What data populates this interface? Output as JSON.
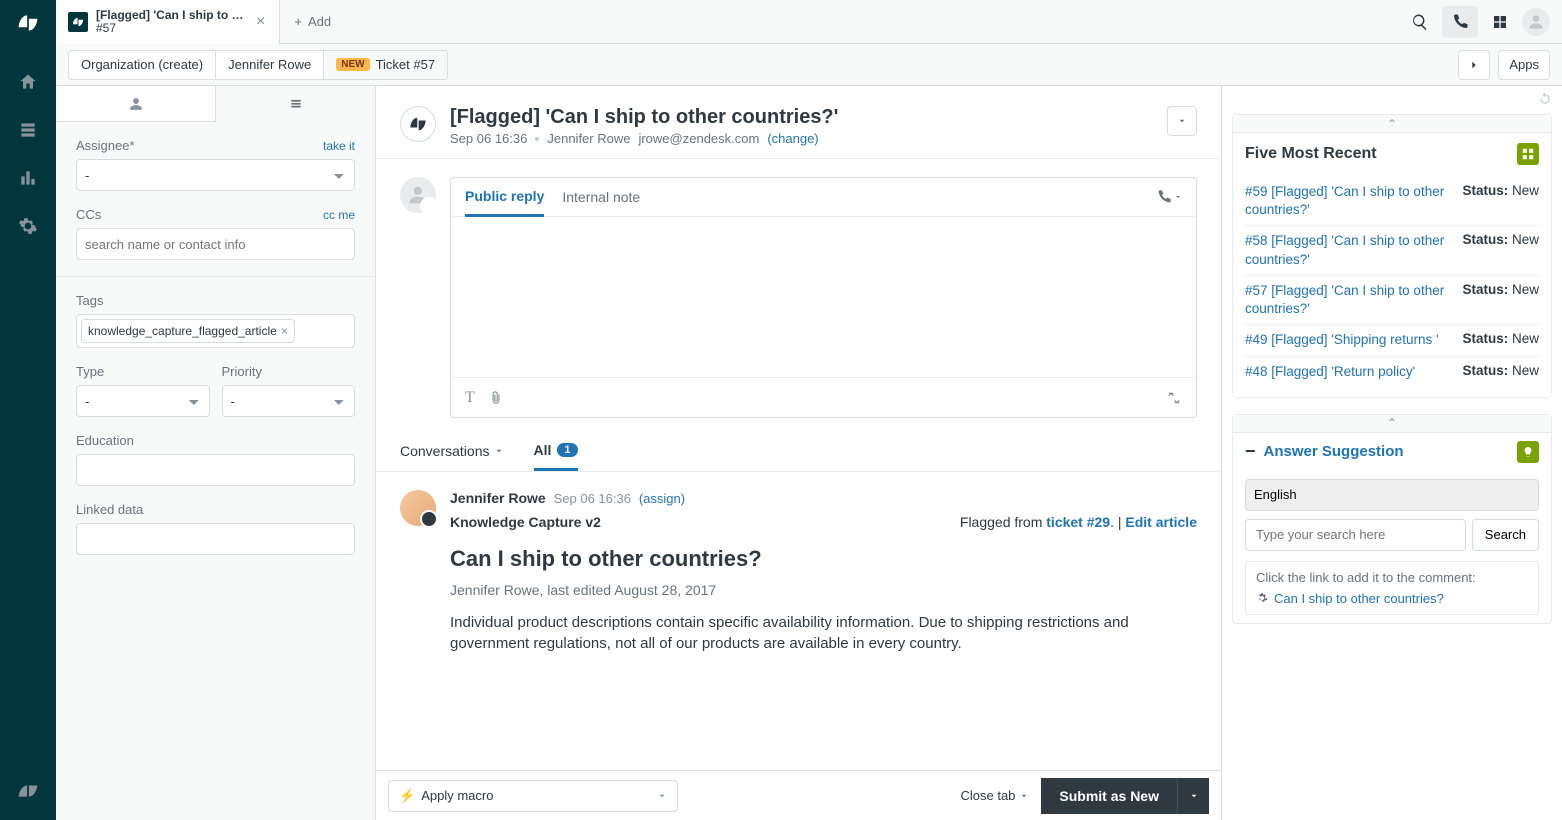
{
  "topbar": {
    "tab_title": "[Flagged] 'Can I ship to o...",
    "tab_subtitle": "#57",
    "add_label": "Add"
  },
  "subbar": {
    "crumb1": "Organization (create)",
    "crumb2": "Jennifer Rowe",
    "crumb3_badge": "NEW",
    "crumb3": "Ticket #57",
    "apps_label": "Apps"
  },
  "left": {
    "assignee_label": "Assignee*",
    "take_it": "take it",
    "assignee_value": "-",
    "ccs_label": "CCs",
    "cc_me": "cc me",
    "ccs_placeholder": "search name or contact info",
    "tags_label": "Tags",
    "tag1": "knowledge_capture_flagged_article",
    "type_label": "Type",
    "type_value": "-",
    "priority_label": "Priority",
    "priority_value": "-",
    "education_label": "Education",
    "linked_label": "Linked data"
  },
  "ticket": {
    "title": "[Flagged] 'Can I ship to other countries?'",
    "date": "Sep 06 16:36",
    "requester": "Jennifer Rowe",
    "email": "jrowe@zendesk.com",
    "change": "(change)",
    "public_reply": "Public reply",
    "internal_note": "Internal note",
    "conversations": "Conversations",
    "all": "All",
    "all_count": "1"
  },
  "conv": {
    "name": "Jennifer Rowe",
    "time": "Sep 06 16:36",
    "assign": "(assign)",
    "kc_title": "Knowledge Capture v2",
    "flagged_from": "Flagged from ",
    "ticket_link": "ticket #29",
    "sep": ". | ",
    "edit_article": "Edit article",
    "article_title": "Can I ship to other countries?",
    "article_meta": "Jennifer Rowe, last edited August 28, 2017",
    "article_body": "Individual product descriptions contain specific availability information. Due to shipping restrictions and government regulations, not all of our products are available in every country."
  },
  "foot": {
    "macro": "Apply macro",
    "close_tab": "Close tab",
    "submit": "Submit as New"
  },
  "right": {
    "recent_title": "Five Most Recent",
    "items": [
      {
        "title": "#59 [Flagged] 'Can I ship to other countries?'",
        "status": "New"
      },
      {
        "title": "#58 [Flagged] 'Can I ship to other countries?'",
        "status": "New"
      },
      {
        "title": "#57 [Flagged] 'Can I ship to other countries?'",
        "status": "New"
      },
      {
        "title": "#49 [Flagged] 'Shipping returns '",
        "status": "New"
      },
      {
        "title": "#48 [Flagged] 'Return policy'",
        "status": "New"
      }
    ],
    "status_label": "Status:",
    "as_title": "Answer Suggestion",
    "lang": "English",
    "search_placeholder": "Type your search here",
    "search_btn": "Search",
    "hint": "Click the link to add it to the comment:",
    "suggestion": "Can I ship to other countries?"
  }
}
